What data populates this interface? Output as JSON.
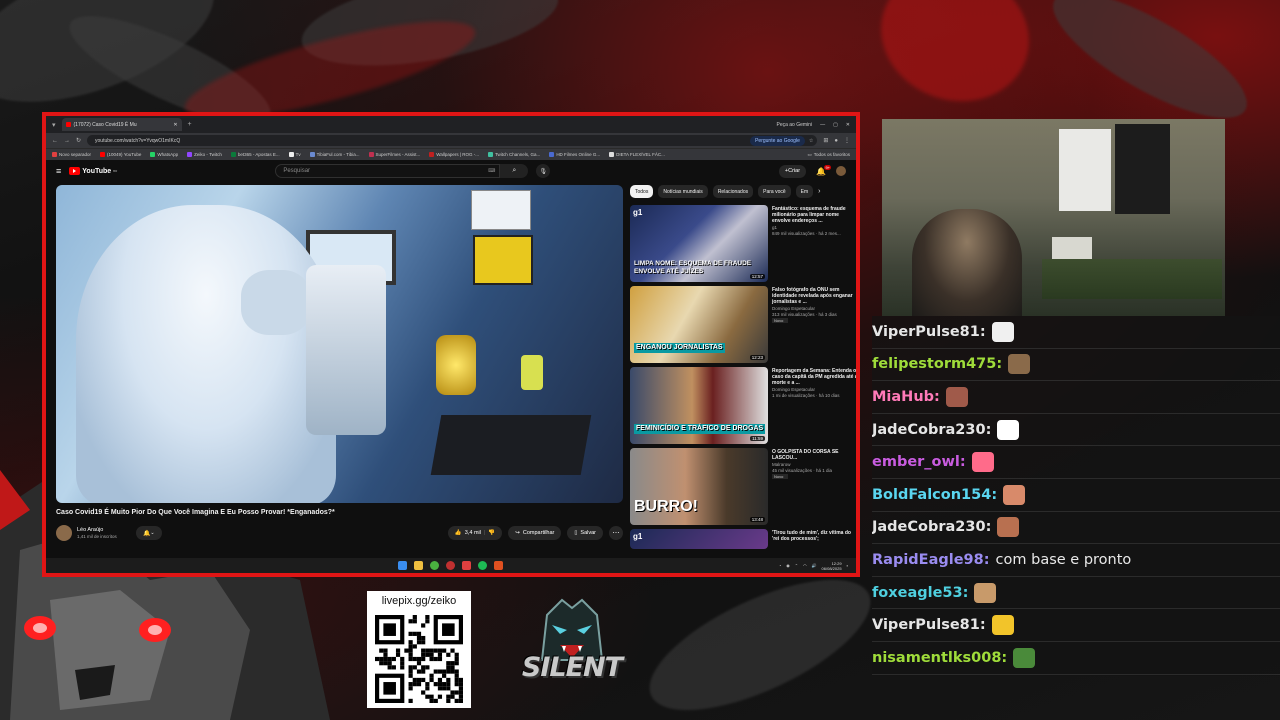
{
  "browser": {
    "tab_title": "(17072) Caso Covid19 É Mu",
    "url": "youtube.com/watch?v=YvqwO1mIKcQ",
    "gemini_label": "Pergunte ao Google",
    "gemini_right": "Peça ao Gemini",
    "bookmarks": [
      "Novo separador",
      "(10049) YouTube",
      "WhatsApp",
      "Zeiko - Twitch",
      "bet365 - Apostas E...",
      "Tv",
      "TibiaFul.com - Tibia...",
      "SuperFilmes - Assist...",
      "Wallpapers | ROG -...",
      "Twitch Channels, Ga...",
      "HD Filmes Online G...",
      "DIETA FLEXÍVEL FÁC..."
    ],
    "bookmarks_right": "Todos os favoritos"
  },
  "youtube": {
    "logo": "YouTube",
    "logo_region": "BR",
    "search_placeholder": "Pesquisar",
    "create_label": "Criar",
    "notif_count": "9+",
    "video_title": "Caso Covid19 É Muito Pior Do Que Você Imagina E Eu Posso Provar! *Enganados?*",
    "channel_name": "Léo Araújo",
    "channel_subs": "1,41 mil de inscritos",
    "likes": "3,4 mil",
    "share_label": "Compartilhar",
    "save_label": "Salvar",
    "chips": [
      "Todos",
      "Notícias mundiais",
      "Relacionados",
      "Para você",
      "Em"
    ],
    "recommendations": [
      {
        "title": "Fantástico: esquema de fraude milionário para limpar nome envolve endereços ...",
        "channel": "g1",
        "stats": "849 mil visualizações · há 2 mes...",
        "thumb_caption": "LIMPA NOME: ESQUEMA DE FRAUDE ENVOLVE ATÉ JUÍZES",
        "thumb_tag": "g1",
        "duration": "12:57",
        "new": ""
      },
      {
        "title": "Falso fotógrafo da ONU sem identidade revelada após enganar jornalistas e ...",
        "channel": "Domingo Espetacular",
        "stats": "313 mil visualizações · há 3 dias",
        "thumb_caption": "ENGANOU JORNALISTAS",
        "thumb_tag": "",
        "duration": "12:23",
        "new": "Novo"
      },
      {
        "title": "Reportagem da Semana: Entenda o caso da capitã da PM agredida até a morte e a ...",
        "channel": "Domingo Espetacular",
        "stats": "1 mi de visualizações · há 10 dias",
        "thumb_caption": "FEMINICÍDIO E TRÁFICO DE DROGAS",
        "thumb_tag": "",
        "duration": "11:59",
        "new": ""
      },
      {
        "title": "O GOLPISTA DO CORSA SE LASCOU...",
        "channel": "Malrarow",
        "stats": "45 mil visualizações · há 1 dia",
        "thumb_caption": "BURRO!",
        "thumb_tag": "",
        "duration": "13:48",
        "new": "Novo"
      },
      {
        "title": "'Tirou tudo de mim', diz vítima do 'rei dos processos';",
        "channel": "",
        "stats": "",
        "thumb_caption": "",
        "thumb_tag": "g1",
        "duration": "",
        "new": ""
      }
    ]
  },
  "taskbar": {
    "time": "12:29",
    "date": "06/08/2025"
  },
  "chat": [
    {
      "name": "ViperPulse81:",
      "color": "#e6e6e6",
      "msg": "",
      "emote": "#f0f0f0"
    },
    {
      "name": "felipestorm475:",
      "color": "#9fdc3a",
      "msg": "",
      "emote": "#8a6a4a"
    },
    {
      "name": "MiaHub:",
      "color": "#ff7ab8",
      "msg": "",
      "emote": "#a05a4a"
    },
    {
      "name": "JadeCobra230:",
      "color": "#e6e6e6",
      "msg": "",
      "emote": "#ffffff"
    },
    {
      "name": "ember_owl:",
      "color": "#c95ce0",
      "msg": "",
      "emote": "#ff6b8a"
    },
    {
      "name": "BoldFalcon154:",
      "color": "#5ad6f0",
      "msg": "",
      "emote": "#d88a6a"
    },
    {
      "name": "JadeCobra230:",
      "color": "#e6e6e6",
      "msg": "",
      "emote": "#b87050"
    },
    {
      "name": "RapidEagle98:",
      "color": "#9a8cf0",
      "msg": "com base e pronto",
      "emote": ""
    },
    {
      "name": "foxeagle53:",
      "color": "#4fd0e0",
      "msg": "",
      "emote": "#c89a6a"
    },
    {
      "name": "ViperPulse81:",
      "color": "#e6e6e6",
      "msg": "",
      "emote": "#f2c42a"
    },
    {
      "name": "nisamentlks008:",
      "color": "#9fdc3a",
      "msg": "",
      "emote": "#4a8a3a"
    }
  ],
  "donation": {
    "link": "livepix.gg/zeiko"
  },
  "logo": {
    "text": "SILENT"
  }
}
